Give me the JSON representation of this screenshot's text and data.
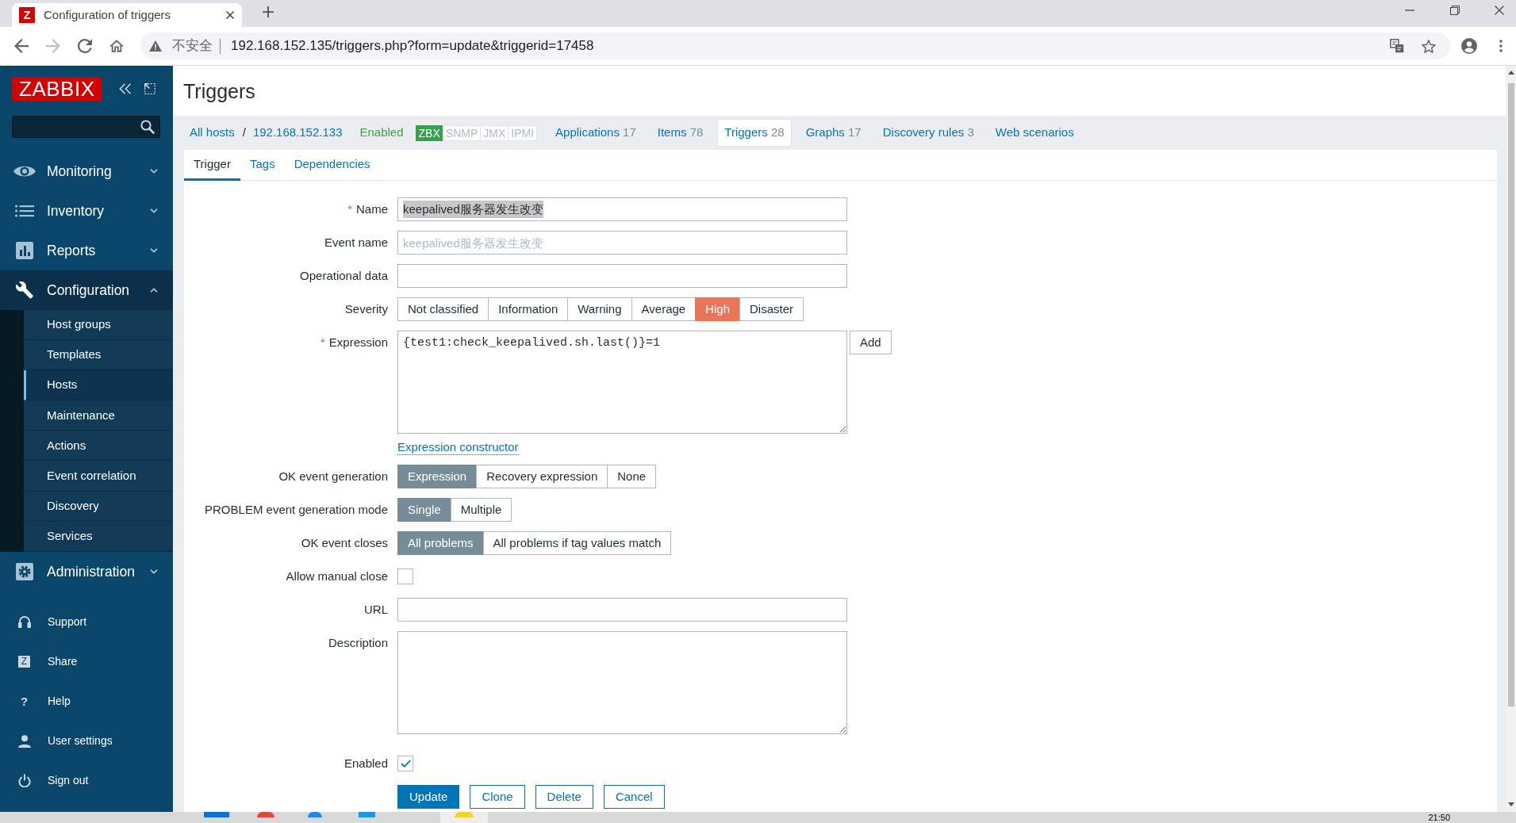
{
  "browser": {
    "tab": {
      "favicon": "Z",
      "title": "Configuration of triggers"
    },
    "forward_disabled": true,
    "omnibox": {
      "security_label": "不安全",
      "url": "192.168.152.135/triggers.php?form=update&triggerid=17458"
    }
  },
  "sidebar": {
    "logo": "ZABBIX",
    "menu": [
      {
        "label": "Monitoring",
        "expanded": false
      },
      {
        "label": "Inventory",
        "expanded": false
      },
      {
        "label": "Reports",
        "expanded": false
      },
      {
        "label": "Configuration",
        "expanded": true,
        "children": [
          {
            "label": "Host groups",
            "selected": false
          },
          {
            "label": "Templates",
            "selected": false
          },
          {
            "label": "Hosts",
            "selected": true
          },
          {
            "label": "Maintenance",
            "selected": false
          },
          {
            "label": "Actions",
            "selected": false
          },
          {
            "label": "Event correlation",
            "selected": false
          },
          {
            "label": "Discovery",
            "selected": false
          },
          {
            "label": "Services",
            "selected": false
          }
        ]
      },
      {
        "label": "Administration",
        "expanded": false
      }
    ],
    "footer": [
      {
        "label": "Support"
      },
      {
        "label": "Share",
        "glyph": "Z",
        "glyph_boxed": true
      },
      {
        "label": "Help",
        "glyph": "?",
        "glyph_boxed": false
      },
      {
        "label": "User settings"
      },
      {
        "label": "Sign out"
      }
    ]
  },
  "page": {
    "title": "Triggers"
  },
  "host_nav": {
    "breadcrumbs": [
      {
        "label": "All hosts"
      },
      {
        "label": "192.168.152.133"
      }
    ],
    "separator": "/",
    "status": "Enabled",
    "availability": [
      {
        "label": "ZBX",
        "on": true
      },
      {
        "label": "SNMP",
        "on": false
      },
      {
        "label": "JMX",
        "on": false
      },
      {
        "label": "IPMI",
        "on": false
      }
    ],
    "links": [
      {
        "label": "Applications",
        "count": "17",
        "selected": false
      },
      {
        "label": "Items",
        "count": "78",
        "selected": false
      },
      {
        "label": "Triggers",
        "count": "28",
        "selected": true
      },
      {
        "label": "Graphs",
        "count": "17",
        "selected": false
      },
      {
        "label": "Discovery rules",
        "count": "3",
        "selected": false
      },
      {
        "label": "Web scenarios",
        "selected": false
      }
    ]
  },
  "tabs": [
    {
      "label": "Trigger",
      "selected": true
    },
    {
      "label": "Tags",
      "selected": false
    },
    {
      "label": "Dependencies",
      "selected": false
    }
  ],
  "form": {
    "fields": [
      {
        "kind": "text",
        "label": "Name",
        "required_mark": "*",
        "value": "keepalived服务器发生改变",
        "value_selected": true
      },
      {
        "kind": "text",
        "label": "Event name",
        "placeholder": "keepalived服务器发生改变"
      },
      {
        "kind": "text",
        "label": "Operational data"
      },
      {
        "kind": "segmented",
        "label": "Severity",
        "options": [
          {
            "label": "Not classified",
            "selected": false
          },
          {
            "label": "Information",
            "selected": false
          },
          {
            "label": "Warning",
            "selected": false
          },
          {
            "label": "Average",
            "selected": false
          },
          {
            "label": "High",
            "selected": true,
            "color": "#e97659"
          },
          {
            "label": "Disaster",
            "selected": false
          }
        ]
      },
      {
        "kind": "expression",
        "label": "Expression",
        "required_mark": "*",
        "value": "{test1:check_keepalived.sh.last()}=1",
        "button": "Add",
        "link": "Expression constructor"
      },
      {
        "kind": "segmented",
        "label": "OK event generation",
        "options": [
          {
            "label": "Expression",
            "selected": true
          },
          {
            "label": "Recovery expression",
            "selected": false
          },
          {
            "label": "None",
            "selected": false
          }
        ]
      },
      {
        "kind": "segmented",
        "label": "PROBLEM event generation mode",
        "options": [
          {
            "label": "Single",
            "selected": true
          },
          {
            "label": "Multiple",
            "selected": false
          }
        ]
      },
      {
        "kind": "segmented",
        "label": "OK event closes",
        "options": [
          {
            "label": "All problems",
            "selected": true
          },
          {
            "label": "All problems if tag values match",
            "selected": false
          }
        ]
      },
      {
        "kind": "checkbox",
        "label": "Allow manual close",
        "checked": false
      },
      {
        "kind": "text",
        "label": "URL"
      },
      {
        "kind": "textarea",
        "label": "Description"
      },
      {
        "kind": "checkbox",
        "label": "Enabled",
        "checked": true
      }
    ],
    "actions": [
      {
        "label": "Update",
        "kind": "primary"
      },
      {
        "label": "Clone",
        "kind": "secondary"
      },
      {
        "label": "Delete",
        "kind": "secondary"
      },
      {
        "label": "Cancel",
        "kind": "secondary"
      }
    ]
  },
  "taskbar": {
    "clock": "21:50"
  }
}
